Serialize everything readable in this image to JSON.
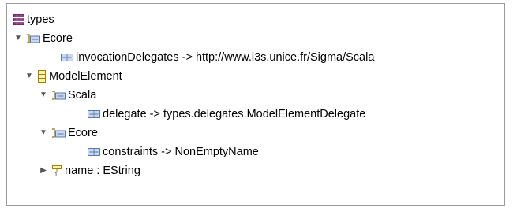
{
  "tree": {
    "root": {
      "label": "types",
      "icon": "package-icon",
      "color": "#7a2b73"
    },
    "nodes": [
      {
        "label": "Ecore",
        "icon": "annotation-icon",
        "expanded": true
      },
      {
        "label": "invocationDelegates -> http://www.i3s.unice.fr/Sigma/Scala",
        "icon": "details-entry-icon"
      },
      {
        "label": "ModelElement",
        "icon": "eclass-icon",
        "expanded": true
      },
      {
        "label": "Scala",
        "icon": "annotation-icon",
        "expanded": true
      },
      {
        "label": "delegate -> types.delegates.ModelElementDelegate",
        "icon": "details-entry-icon"
      },
      {
        "label": "Ecore",
        "icon": "annotation-icon",
        "expanded": true
      },
      {
        "label": "constraints -> NonEmptyName",
        "icon": "details-entry-icon"
      },
      {
        "label": "name : EString",
        "icon": "eattribute-icon",
        "expanded": false
      }
    ]
  }
}
